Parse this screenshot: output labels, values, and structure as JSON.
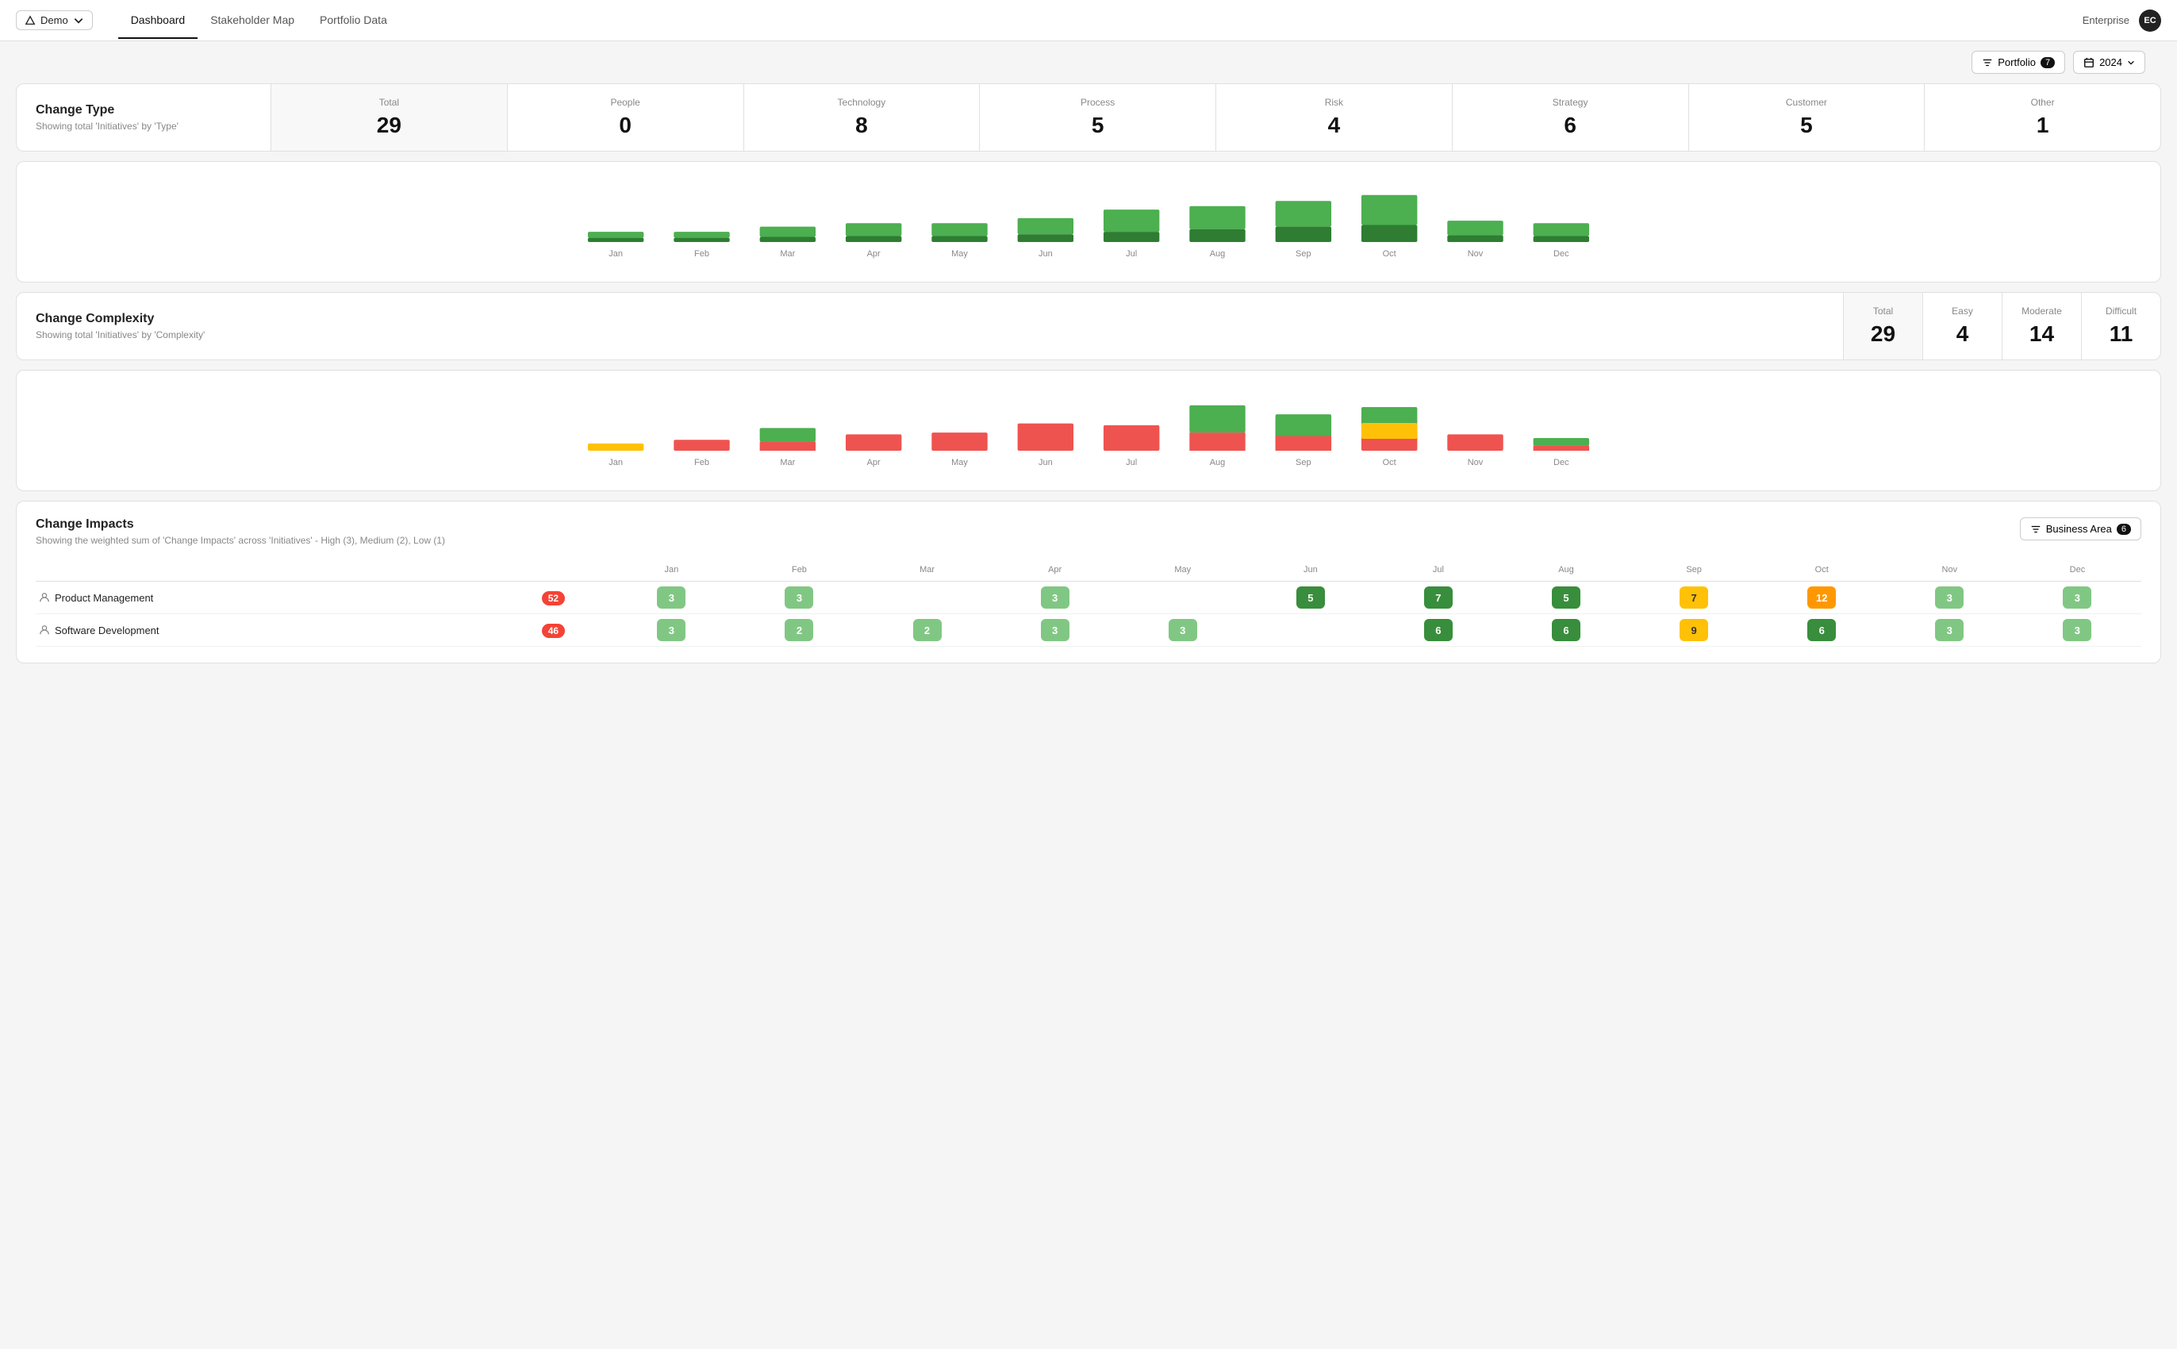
{
  "nav": {
    "demo_label": "Demo",
    "tabs": [
      "Dashboard",
      "Stakeholder Map",
      "Portfolio Data"
    ],
    "active_tab": "Dashboard",
    "enterprise_label": "Enterprise",
    "avatar_initials": "EC"
  },
  "toolbar": {
    "portfolio_label": "Portfolio",
    "portfolio_count": "7",
    "year_label": "2024"
  },
  "change_type": {
    "title": "Change Type",
    "subtitle": "Showing total 'Initiatives' by 'Type'",
    "stats": [
      {
        "label": "Total",
        "value": "29",
        "is_total": true
      },
      {
        "label": "People",
        "value": "0"
      },
      {
        "label": "Technology",
        "value": "8"
      },
      {
        "label": "Process",
        "value": "5"
      },
      {
        "label": "Risk",
        "value": "4"
      },
      {
        "label": "Strategy",
        "value": "6"
      },
      {
        "label": "Customer",
        "value": "5"
      },
      {
        "label": "Other",
        "value": "1"
      }
    ]
  },
  "change_type_chart": {
    "months": [
      "Jan",
      "Feb",
      "Mar",
      "Apr",
      "May",
      "Jun",
      "Jul",
      "Aug",
      "Sep",
      "Oct",
      "Nov",
      "Dec"
    ],
    "bars": [
      {
        "h1": 12,
        "h2": 5
      },
      {
        "h1": 12,
        "h2": 5
      },
      {
        "h1": 18,
        "h2": 6
      },
      {
        "h1": 22,
        "h2": 7
      },
      {
        "h1": 22,
        "h2": 7
      },
      {
        "h1": 28,
        "h2": 9
      },
      {
        "h1": 38,
        "h2": 12
      },
      {
        "h1": 42,
        "h2": 15
      },
      {
        "h1": 48,
        "h2": 18
      },
      {
        "h1": 55,
        "h2": 20
      },
      {
        "h1": 25,
        "h2": 8
      },
      {
        "h1": 22,
        "h2": 7
      }
    ]
  },
  "change_complexity": {
    "title": "Change Complexity",
    "subtitle": "Showing total 'Initiatives' by 'Complexity'",
    "stats": [
      {
        "label": "Total",
        "value": "29",
        "is_total": true
      },
      {
        "label": "Easy",
        "value": "4"
      },
      {
        "label": "Moderate",
        "value": "14"
      },
      {
        "label": "Difficult",
        "value": "11"
      }
    ]
  },
  "change_impacts": {
    "title": "Change Impacts",
    "subtitle": "Showing the weighted sum of 'Change Impacts' across 'Initiatives' - High (3), Medium (2), Low (1)",
    "filter_label": "Business Area",
    "filter_count": "6",
    "months": [
      "Jan",
      "Feb",
      "Mar",
      "Apr",
      "May",
      "Jun",
      "Jul",
      "Aug",
      "Sep",
      "Oct",
      "Nov",
      "Dec"
    ],
    "rows": [
      {
        "name": "Product Management",
        "total": "52",
        "total_color": "badge-red",
        "cells": [
          {
            "value": "3",
            "color": "score-green-light"
          },
          {
            "value": "3",
            "color": "score-green-light"
          },
          {
            "value": "",
            "color": "score-empty"
          },
          {
            "value": "3",
            "color": "score-green-light"
          },
          {
            "value": "",
            "color": "score-empty"
          },
          {
            "value": "5",
            "color": "score-green-dark"
          },
          {
            "value": "7",
            "color": "score-green-dark"
          },
          {
            "value": "5",
            "color": "score-green-dark"
          },
          {
            "value": "7",
            "color": "score-yellow"
          },
          {
            "value": "12",
            "color": "score-orange"
          },
          {
            "value": "3",
            "color": "score-green-light"
          },
          {
            "value": "3",
            "color": "score-green-light"
          }
        ]
      },
      {
        "name": "Software Development",
        "total": "46",
        "total_color": "badge-red",
        "cells": [
          {
            "value": "3",
            "color": "score-green-light"
          },
          {
            "value": "2",
            "color": "score-green-light"
          },
          {
            "value": "2",
            "color": "score-green-light"
          },
          {
            "value": "3",
            "color": "score-green-light"
          },
          {
            "value": "3",
            "color": "score-green-light"
          },
          {
            "value": "",
            "color": "score-empty"
          },
          {
            "value": "6",
            "color": "score-green-dark"
          },
          {
            "value": "6",
            "color": "score-green-dark"
          },
          {
            "value": "9",
            "color": "score-yellow"
          },
          {
            "value": "6",
            "color": "score-green-dark"
          },
          {
            "value": "3",
            "color": "score-green-light"
          },
          {
            "value": "3",
            "color": "score-green-light"
          }
        ]
      }
    ]
  }
}
